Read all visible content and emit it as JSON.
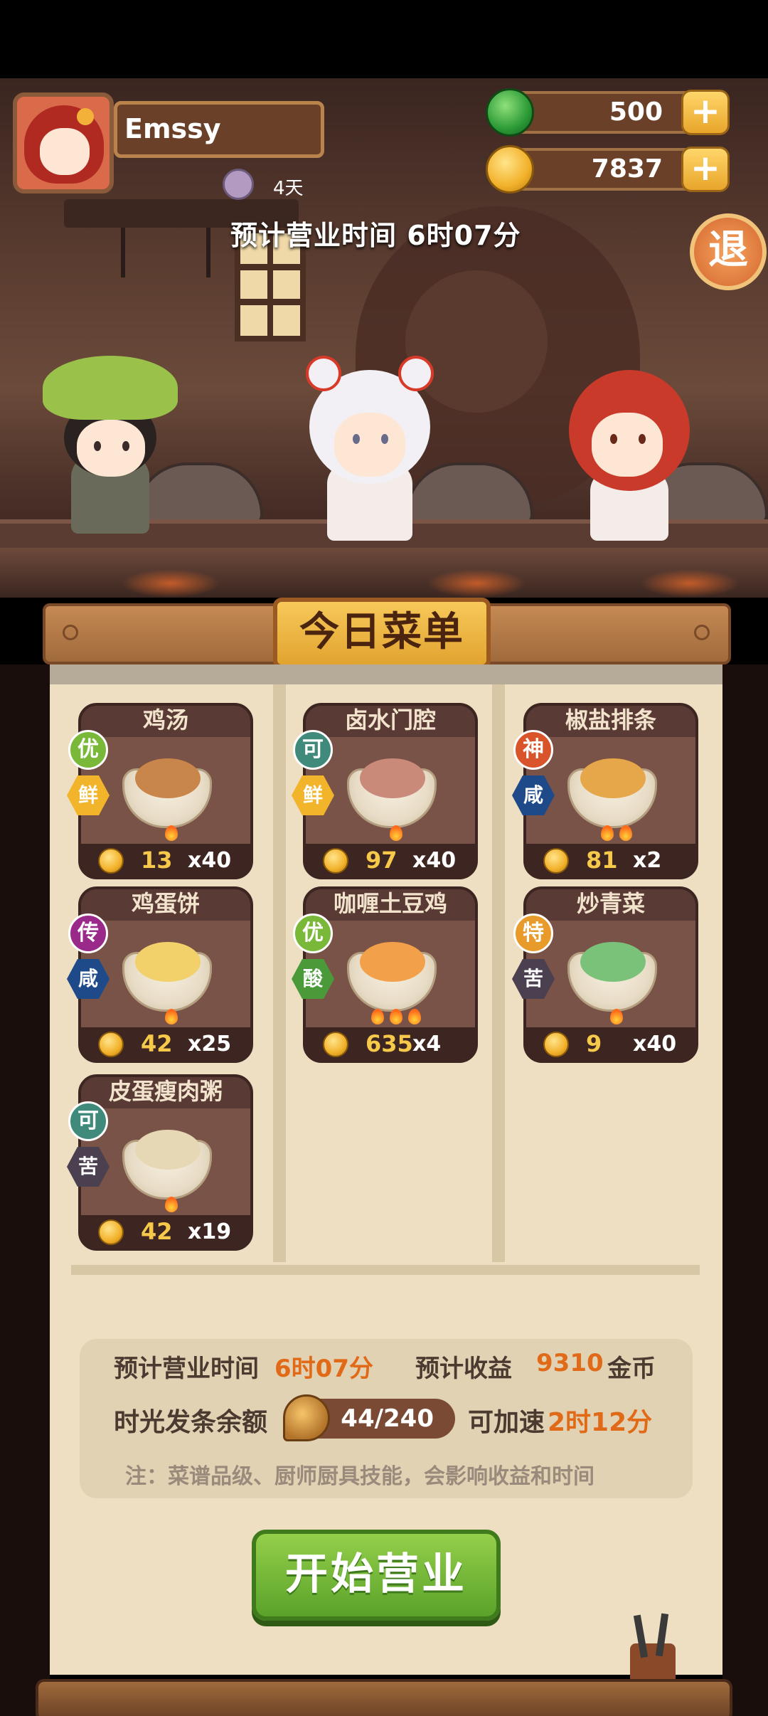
{
  "player": {
    "name": "Emssy",
    "days": "4天",
    "business_time_banner": "预计营业时间 6时07分"
  },
  "resources": {
    "jade": "500",
    "coins": "7837",
    "plus": "+"
  },
  "exit_label": "退",
  "menu": {
    "title": "今日菜单",
    "dishes": [
      {
        "name": "鸡汤",
        "grade": "优",
        "flavor": "鲜",
        "price": "13",
        "qty": "x40",
        "flames": 1
      },
      {
        "name": "卤水门腔",
        "grade": "可",
        "flavor": "鲜",
        "price": "97",
        "qty": "x40",
        "flames": 1
      },
      {
        "name": "椒盐排条",
        "grade": "神",
        "flavor": "咸",
        "price": "81",
        "qty": "x2",
        "flames": 2
      },
      {
        "name": "鸡蛋饼",
        "grade": "传",
        "flavor": "咸",
        "price": "42",
        "qty": "x25",
        "flames": 1
      },
      {
        "name": "咖喱土豆鸡",
        "grade": "优",
        "flavor": "酸",
        "price": "635",
        "qty": "x4",
        "flames": 3
      },
      {
        "name": "炒青菜",
        "grade": "特",
        "flavor": "苦",
        "price": "9",
        "qty": "x40",
        "flames": 1
      },
      {
        "name": "皮蛋瘦肉粥",
        "grade": "可",
        "flavor": "苦",
        "price": "42",
        "qty": "x19",
        "flames": 1
      }
    ]
  },
  "summary": {
    "time_label": "预计营业时间",
    "time_value": "6时07分",
    "income_label": "预计收益",
    "income_value": "9310",
    "income_unit": "金币",
    "balance_label": "时光发条余额",
    "balance_value": "44/240",
    "boost_label": "可加速",
    "boost_value": "2时12分",
    "note": "注：菜谱品级、厨师厨具技能，会影响收益和时间"
  },
  "start_button": "开始营业",
  "colors": {
    "grade_优": "#7ab83a",
    "grade_可": "#3f8a7a",
    "grade_神": "#d9542a",
    "grade_传": "#9a2a8a",
    "grade_特": "#e89a2a",
    "flavor_鲜": "#f2b42a",
    "flavor_咸": "#1f4a8a",
    "flavor_酸": "#4a9a3a",
    "flavor_苦": "#4a4050"
  }
}
